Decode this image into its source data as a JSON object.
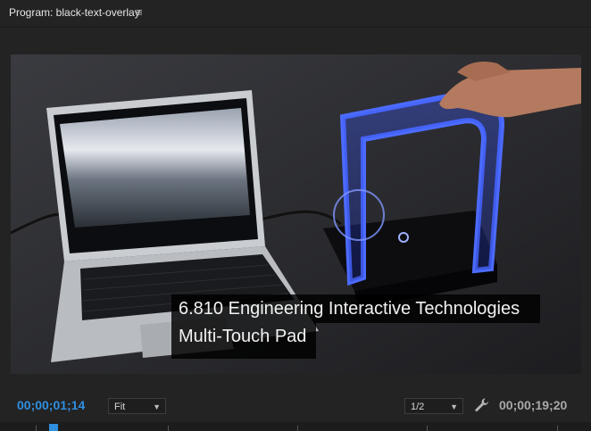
{
  "panel": {
    "title": "Program: black-text-overlay",
    "menu_icon": "hamburger-menu-icon"
  },
  "video": {
    "overlay_line1": "6.810 Engineering Interactive Technologies",
    "overlay_line2": "Multi-Touch Pad"
  },
  "controls": {
    "current_timecode": "00;00;01;14",
    "zoom_level": "Fit",
    "resolution": "1/2",
    "settings_icon": "wrench-icon",
    "duration_timecode": "00;00;19;20",
    "accent_color": "#2f8fe0"
  }
}
